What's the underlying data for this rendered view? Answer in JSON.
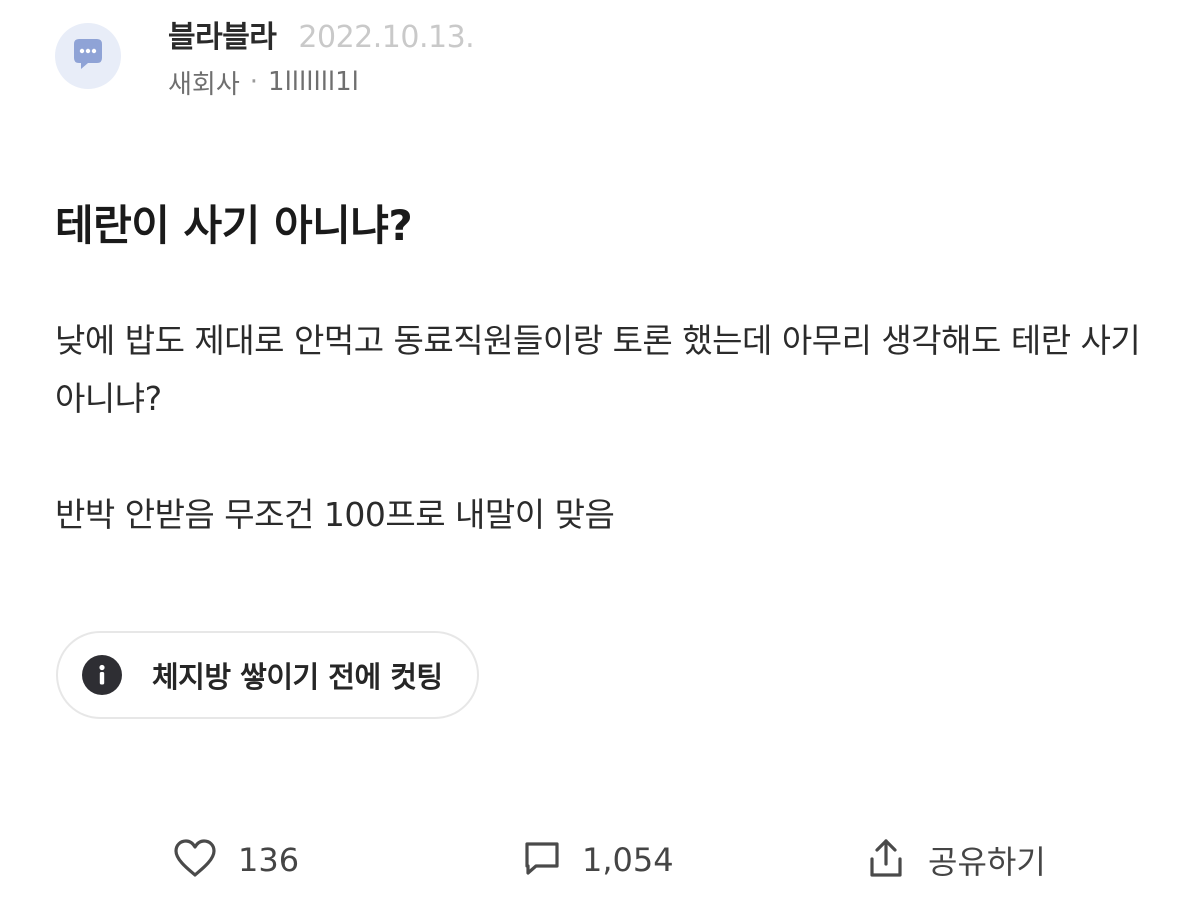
{
  "post": {
    "author": "블라블라",
    "date": "2022.10.13.",
    "company": "새회사",
    "separator": "·",
    "user_id": "1lllllll1l",
    "title": "테란이 사기 아니냐?",
    "paragraphs": [
      "낮에 밥도 제대로 안먹고 동료직원들이랑 토론 했는데 아무리 생각해도 테란 사기 아니냐?",
      "반박 안받음 무조건 100프로 내말이 맞음"
    ]
  },
  "topic": {
    "label": "체지방 쌓이기 전에 컷팅",
    "icon": "info-icon"
  },
  "actions": {
    "likes": "136",
    "comments": "1,054",
    "share_label": "공유하기"
  },
  "colors": {
    "avatar_bg": "#e8edf8",
    "avatar_bubble": "#8fa3d6",
    "date": "#c9c9c9",
    "info_circle": "#2e2e33"
  }
}
